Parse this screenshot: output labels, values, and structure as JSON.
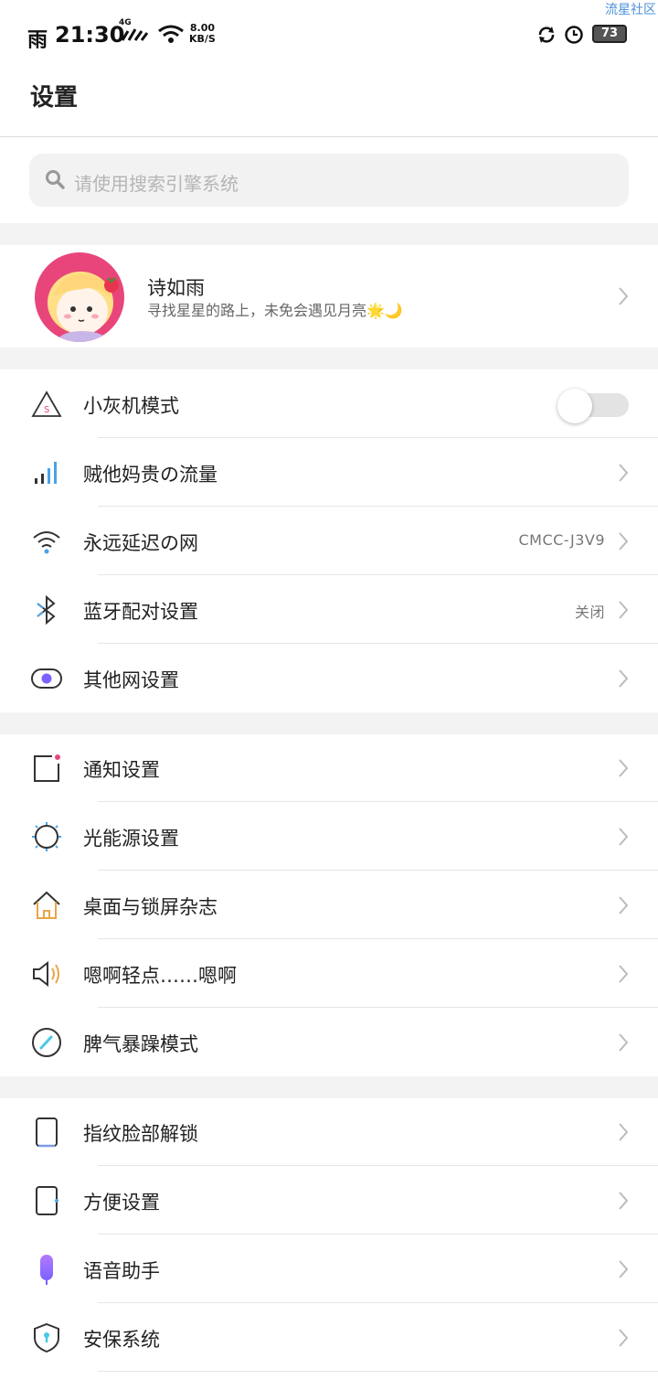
{
  "watermark": "流星社区",
  "status_bar": {
    "weather": "雨",
    "time": "21:30",
    "network": "4G",
    "speed_value": "8.00",
    "speed_unit": "KB/S",
    "battery": "73"
  },
  "header": {
    "title": "设置"
  },
  "search": {
    "placeholder": "请使用搜索引擎系统"
  },
  "profile": {
    "name": "诗如雨",
    "signature": "寻找星星的路上，未免会遇见月亮🌟🌙"
  },
  "section1": [
    {
      "label": "小灰机模式",
      "icon": "airplane-mode-icon",
      "toggle": false
    },
    {
      "label": "贼他妈贵の流量",
      "icon": "mobile-data-icon"
    },
    {
      "label": "永远延迟の网",
      "icon": "wifi-icon",
      "value": "CMCC-J3V9"
    },
    {
      "label": "蓝牙配对设置",
      "icon": "bluetooth-icon",
      "value": "关闭"
    },
    {
      "label": "其他网设置",
      "icon": "other-network-icon"
    }
  ],
  "section2": [
    {
      "label": "通知设置",
      "icon": "notification-icon"
    },
    {
      "label": "光能源设置",
      "icon": "brightness-icon"
    },
    {
      "label": "桌面与锁屏杂志",
      "icon": "home-icon"
    },
    {
      "label": "嗯啊轻点……嗯啊",
      "icon": "sound-icon"
    },
    {
      "label": "脾气暴躁模式",
      "icon": "motion-mode-icon"
    }
  ],
  "section3": [
    {
      "label": "指纹脸部解锁",
      "icon": "fingerprint-face-icon"
    },
    {
      "label": "方便设置",
      "icon": "convenience-icon"
    },
    {
      "label": "语音助手",
      "icon": "microphone-icon"
    },
    {
      "label": "安保系统",
      "icon": "shield-icon"
    }
  ],
  "colors": {
    "accent_purple": "#7b61ff",
    "avatar_bg": "#e8467a",
    "watermark": "#4a90d9"
  }
}
